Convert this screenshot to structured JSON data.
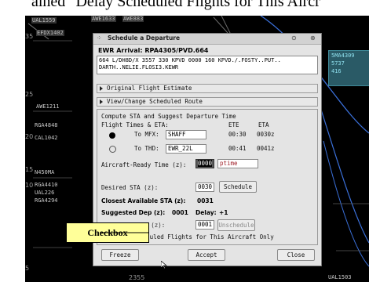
{
  "caption": "ained \"Delay Scheduled Flights for This Aircr",
  "radar": {
    "tags": [
      "UAL1559",
      "AWE1633",
      "AWE883",
      "EFDX1402",
      "AWE1211",
      "RGA4848",
      "CAL1042",
      "N450MA",
      "RGA4410",
      "UAL226",
      "RGA4294",
      "UAL1503"
    ],
    "nums": [
      "35",
      "25",
      "20",
      "15",
      "10",
      "5",
      "2355"
    ],
    "cyan": [
      "5MA4309",
      "5737",
      "416"
    ],
    "bottom": [
      "UAL1593",
      "2355"
    ]
  },
  "dialog": {
    "window_title": "Schedule a Departure",
    "arrival_header": "EWR Arrival: RPA4305/PVD.664",
    "route_text": "664 L/DH8D/X 3557 330 KPVD 0000 160 KPVD./.FOSTY..PUT.. DARTH..NELIE.FLOSI3.KEWR",
    "sections": {
      "original_estimate": "Original Flight Estimate",
      "change_route": "View/Change Scheduled Route"
    },
    "compute_title": "Compute STA and Suggest Departure Time",
    "times_header": "Flight Times & ETA:",
    "col_ete": "ETE",
    "col_eta": "ETA",
    "rows": [
      {
        "label": "To MFX:",
        "fix": "SHAFF",
        "ete": "00:30",
        "eta": "0030z"
      },
      {
        "label": "To THD:",
        "fix": "EWR_22L",
        "ete": "00:41",
        "eta": "0041z"
      }
    ],
    "aircraft_ready_label": "Aircraft-Ready Time (z):",
    "aircraft_ready_value": "0000",
    "aircraft_ready_tag": "ptime",
    "desired_sta_label": "Desired STA (z):",
    "desired_sta_value": "0030",
    "schedule_label": "Schedule",
    "closest_label": "Closest Available STA (z):",
    "closest_value": "0031",
    "suggested_label": "Suggested Dep (z):",
    "suggested_value": "0001",
    "delay_label": "Delay:",
    "delay_value": "+1",
    "scheduled_dep_label": "Scheduled Dep (z):",
    "scheduled_dep_value": "0001",
    "unschedule_label": "Unschedule",
    "checkbox_label": "Delay Scheduled Flights for This Aircraft Only",
    "checkbox_checked": true,
    "freeze_label": "Freeze",
    "accept_label": "Accept",
    "close_label": "Close"
  },
  "callout": "Checkbox"
}
